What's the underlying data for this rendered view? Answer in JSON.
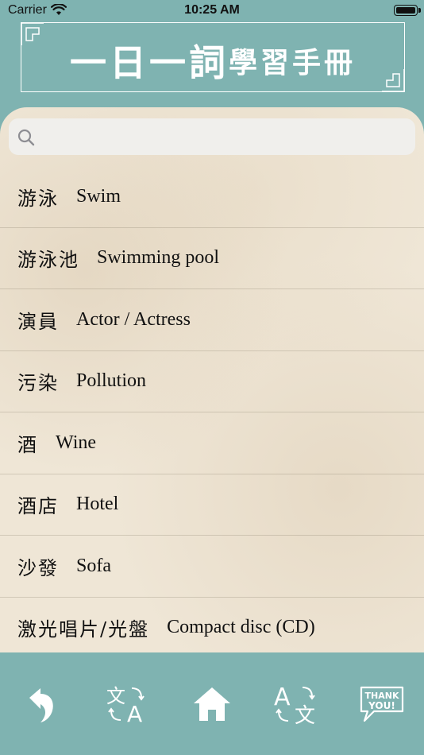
{
  "status_bar": {
    "carrier": "Carrier",
    "time": "10:25 AM"
  },
  "header": {
    "title_main": "一日一詞",
    "title_sub": "學習手冊"
  },
  "search": {
    "value": "",
    "placeholder": ""
  },
  "words": [
    {
      "zh": "游泳",
      "en": "Swim"
    },
    {
      "zh": "游泳池",
      "en": "Swimming pool"
    },
    {
      "zh": "演員",
      "en": "Actor / Actress"
    },
    {
      "zh": "污染",
      "en": "Pollution"
    },
    {
      "zh": "酒",
      "en": "Wine"
    },
    {
      "zh": "酒店",
      "en": "Hotel"
    },
    {
      "zh": "沙發",
      "en": "Sofa"
    },
    {
      "zh": "激光唱片/光盤",
      "en": "Compact disc (CD)"
    }
  ],
  "tab_bar": {
    "icons": [
      "undo-icon",
      "translate-zh-en-icon",
      "home-icon",
      "translate-en-zh-icon",
      "thank-you-icon"
    ],
    "thank_you_label": "THANK YOU!",
    "translate_zh_char": "文",
    "translate_en_char": "A"
  },
  "colors": {
    "background": "#7fb3b1",
    "paper": "#efe6d6",
    "icon": "#ffffff"
  }
}
